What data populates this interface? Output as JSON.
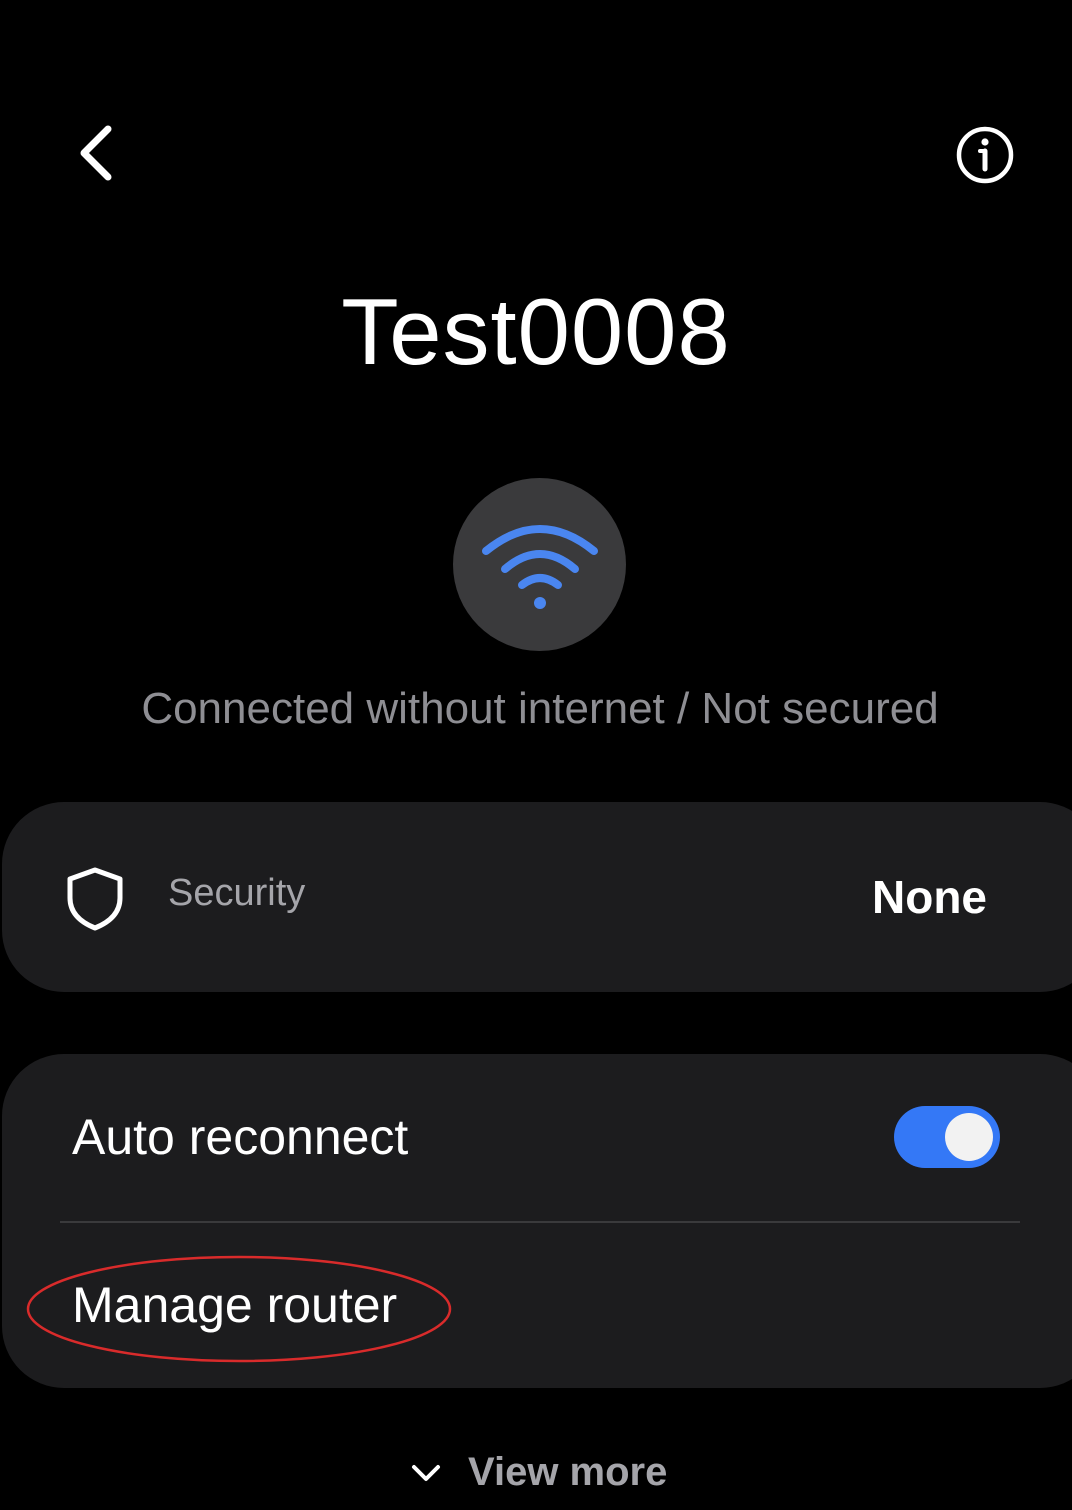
{
  "header": {
    "back_icon": "chevron-left-icon",
    "info_icon": "info-circle-icon"
  },
  "network": {
    "name": "Test0008",
    "status": "Connected without internet / Not secured",
    "signal_icon": "wifi-icon",
    "signal_color": "#4a86f0"
  },
  "security": {
    "icon": "shield-icon",
    "label": "Security",
    "value": "None"
  },
  "settings": {
    "auto_reconnect": {
      "label": "Auto reconnect",
      "enabled": true,
      "toggle_color": "#3478f6"
    },
    "manage_router": {
      "label": "Manage router",
      "highlight_color": "#d92b2b"
    }
  },
  "footer": {
    "view_more_label": "View more",
    "view_more_icon": "chevron-down-icon"
  }
}
